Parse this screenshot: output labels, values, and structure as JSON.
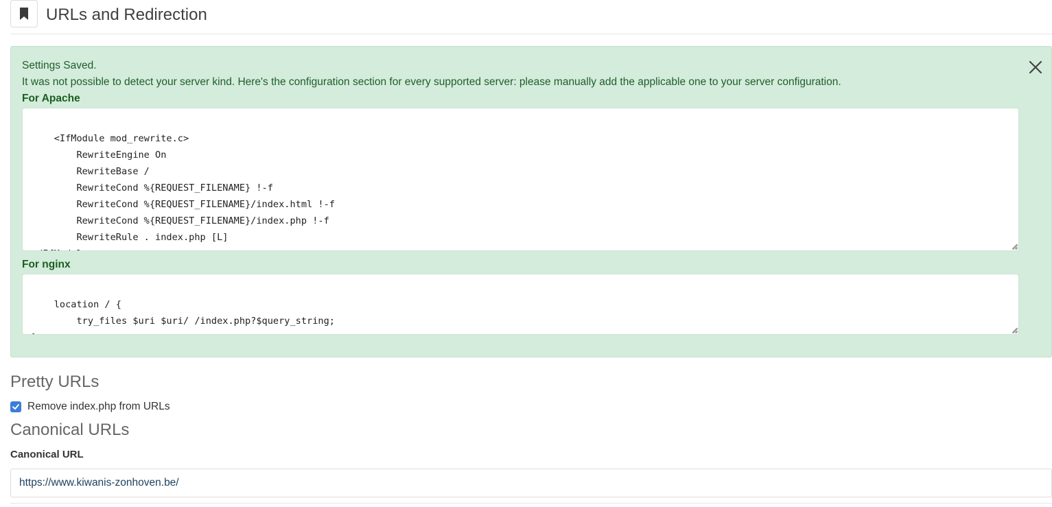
{
  "header": {
    "title": "URLs and Redirection",
    "icon": "bookmark-icon"
  },
  "alert": {
    "line1": "Settings Saved.",
    "line2": "It was not possible to detect your server kind. Here's the configuration section for every supported server: please manually add the applicable one to your server configuration.",
    "close_icon": "close-icon",
    "apache": {
      "label": "For Apache",
      "code": "<IfModule mod_rewrite.c>\n        RewriteEngine On\n        RewriteBase /\n        RewriteCond %{REQUEST_FILENAME} !-f\n        RewriteCond %{REQUEST_FILENAME}/index.html !-f\n        RewriteCond %{REQUEST_FILENAME}/index.php !-f\n        RewriteRule . index.php [L]\n</IfModule>"
    },
    "nginx": {
      "label": "For nginx",
      "code": "location / {\n        try_files $uri $uri/ /index.php?$query_string;\n}"
    }
  },
  "pretty_urls": {
    "heading": "Pretty URLs",
    "checkbox_label": "Remove index.php from URLs",
    "checked": true
  },
  "canonical_urls": {
    "heading": "Canonical URLs",
    "field_label": "Canonical URL",
    "value": "https://www.kiwanis-zonhoven.be/"
  },
  "colors": {
    "alert_bg": "#d4ecdb",
    "alert_text": "#1e5e2c",
    "checkbox": "#3b7dd8"
  }
}
